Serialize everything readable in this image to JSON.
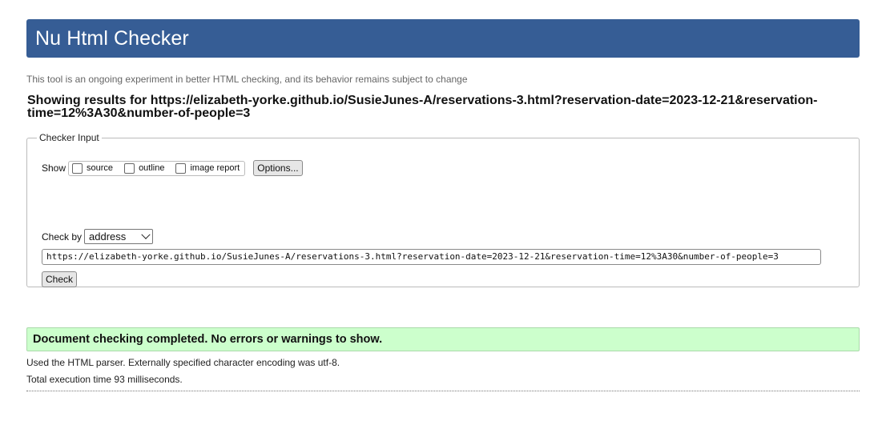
{
  "header": {
    "title": "Nu Html Checker"
  },
  "intro": "This tool is an ongoing experiment in better HTML checking, and its behavior remains subject to change",
  "results_heading": "Showing results for https://elizabeth-yorke.github.io/SusieJunes-A/reservations-3.html?reservation-date=2023-12-21&reservation-time=12%3A30&number-of-people=3",
  "checker_input": {
    "legend": "Checker Input",
    "show_label": "Show",
    "show_options": [
      {
        "label": "source",
        "checked": false
      },
      {
        "label": "outline",
        "checked": false
      },
      {
        "label": "image report",
        "checked": false
      }
    ],
    "options_button": "Options...",
    "check_by_label": "Check by",
    "check_by_value": "address",
    "url_value": "https://elizabeth-yorke.github.io/SusieJunes-A/reservations-3.html?reservation-date=2023-12-21&reservation-time=12%3A30&number-of-people=3",
    "check_button": "Check"
  },
  "result": {
    "message": "Document checking completed. No errors or warnings to show.",
    "color": "#ccffcc"
  },
  "details": [
    "Used the HTML parser. Externally specified character encoding was utf-8.",
    "Total execution time 93 milliseconds."
  ],
  "colors": {
    "header_bg": "#365d95",
    "success_bg": "#ccffcc"
  },
  "icons": {
    "checkbox": "checkbox-unchecked-icon",
    "dropdown": "chevron-down-icon"
  }
}
